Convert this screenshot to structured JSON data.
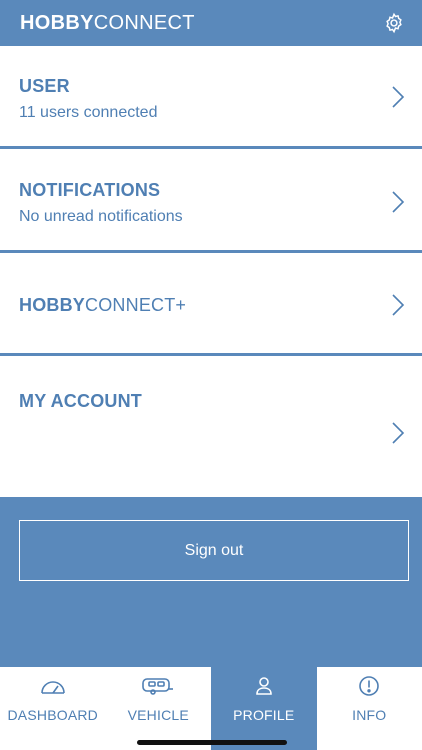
{
  "header": {
    "brand_bold": "HOBBY",
    "brand_light": "CONNECT",
    "settings_icon": "gear-icon"
  },
  "rows": {
    "user": {
      "title": "USER",
      "subtitle": "11 users connected"
    },
    "notifications": {
      "title": "NOTIFICATIONS",
      "subtitle": "No unread notifications"
    },
    "plus": {
      "title_bold": "HOBBY",
      "title_light": "CONNECT+"
    },
    "account": {
      "title": "MY ACCOUNT"
    }
  },
  "signout": {
    "label": "Sign out"
  },
  "tabs": [
    {
      "label": "DASHBOARD",
      "icon": "speedometer-icon",
      "active": false
    },
    {
      "label": "VEHICLE",
      "icon": "caravan-icon",
      "active": false
    },
    {
      "label": "PROFILE",
      "icon": "person-icon",
      "active": true
    },
    {
      "label": "INFO",
      "icon": "info-icon",
      "active": false
    }
  ],
  "colors": {
    "brand_blue": "#5a89bb",
    "text_blue": "#4f7fb3",
    "white": "#ffffff"
  }
}
